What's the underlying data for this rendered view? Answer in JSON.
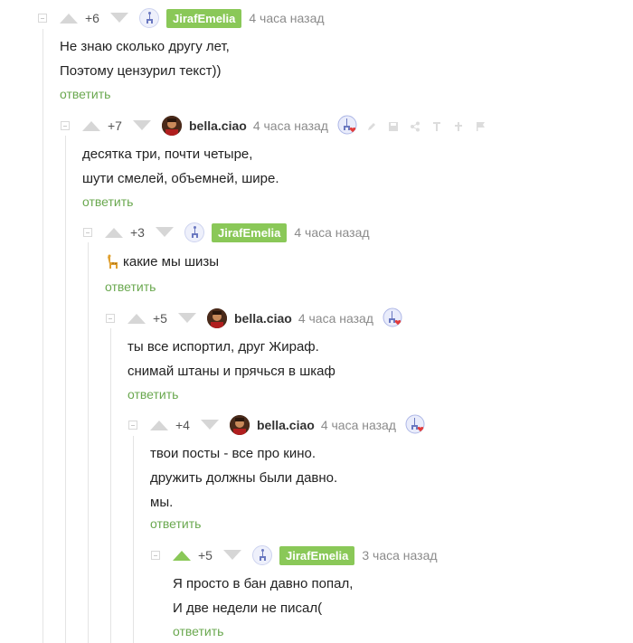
{
  "comments": [
    {
      "rating": "+6",
      "author": "JirafEmelia",
      "time": "4 часа назад",
      "lines": [
        "Не знаю сколько другу лет,",
        "Поэтому цензурил текст))"
      ],
      "reply": "ответить"
    },
    {
      "rating": "+7",
      "author": "bella.ciao",
      "time": "4 часа назад",
      "lines": [
        "десятка три, почти четыре,",
        "шути смелей, объемней, шире."
      ],
      "reply": "ответить"
    },
    {
      "rating": "+3",
      "author": "JirafEmelia",
      "time": "4 часа назад",
      "lines": [
        "какие мы шизы"
      ],
      "reply": "ответить"
    },
    {
      "rating": "+5",
      "author": "bella.ciao",
      "time": "4 часа назад",
      "lines": [
        "ты все испортил, друг Жираф.",
        "снимай штаны и прячься в шкаф"
      ],
      "reply": "ответить"
    },
    {
      "rating": "+4",
      "author": "bella.ciao",
      "time": "4 часа назад",
      "lines": [
        "твои посты - все про кино.",
        "дружить должны были давно.",
        "мы."
      ],
      "reply": "ответить"
    },
    {
      "rating": "+5",
      "author": "JirafEmelia",
      "time": "3 часа назад",
      "lines": [
        "Я просто в бан давно попал,",
        "И две недели не писал("
      ],
      "reply": "ответить"
    }
  ],
  "colors": {
    "accent_green": "#8ac858",
    "reply_green": "#6aa84f",
    "vote_gray": "#d6d6d6",
    "vote_active": "#8ac858"
  }
}
